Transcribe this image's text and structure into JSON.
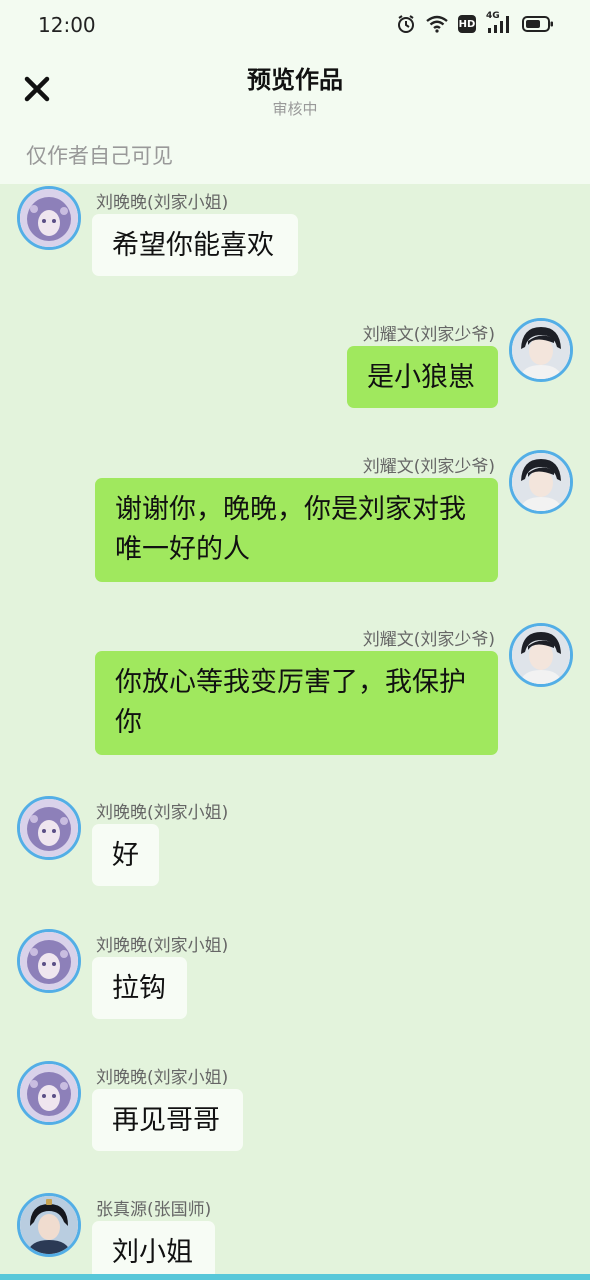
{
  "status_bar": {
    "time": "12:00",
    "network": "4G",
    "hd": "HD"
  },
  "header": {
    "title": "预览作品",
    "subtitle": "审核中",
    "visibility_note": "仅作者自己可见"
  },
  "messages": [
    {
      "side": "left",
      "sender": "刘晚晚(刘家小姐)",
      "text": "希望你能喜欢"
    },
    {
      "side": "right",
      "sender": "刘耀文(刘家少爷)",
      "text": "是小狼崽"
    },
    {
      "side": "right",
      "sender": "刘耀文(刘家少爷)",
      "text": "谢谢你，晚晚，你是刘家对我唯一好的人"
    },
    {
      "side": "right",
      "sender": "刘耀文(刘家少爷)",
      "text": "你放心等我变厉害了，我保护你"
    },
    {
      "side": "left",
      "sender": "刘晚晚(刘家小姐)",
      "text": "好"
    },
    {
      "side": "left",
      "sender": "刘晚晚(刘家小姐)",
      "text": "拉钩"
    },
    {
      "side": "left",
      "sender": "刘晚晚(刘家小姐)",
      "text": "再见哥哥"
    },
    {
      "side": "left",
      "sender": "张真源(张国师)",
      "text": "刘小姐"
    }
  ]
}
